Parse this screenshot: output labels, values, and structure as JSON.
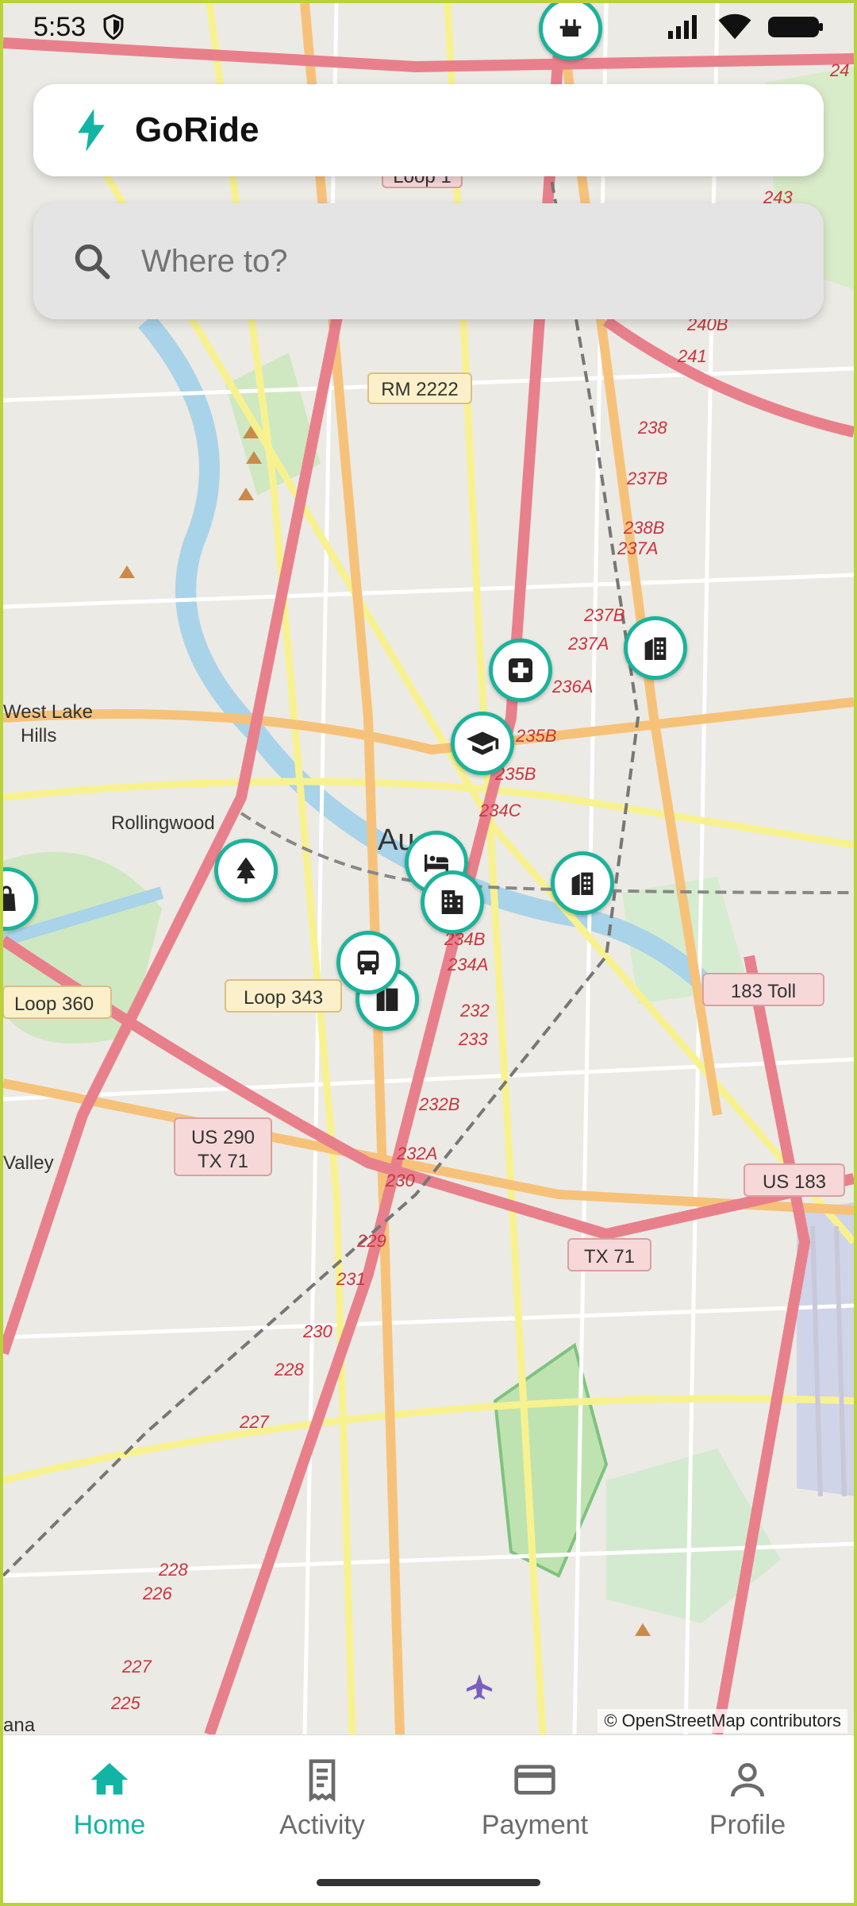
{
  "status": {
    "time": "5:53"
  },
  "brand": {
    "name": "GoRide",
    "accent": "#12b5a3"
  },
  "search": {
    "placeholder": "Where to?"
  },
  "map": {
    "places": [
      "West Lake",
      "Hills",
      "Rollingwood",
      "Valley",
      "Au",
      "ana"
    ],
    "shields": [
      "RM 2222",
      "Loop 1",
      "Loop 360",
      "Loop 343",
      "US 290",
      "TX 71",
      "183 Toll",
      "US 183",
      "TX 71"
    ],
    "exits": [
      "240B",
      "241",
      "243",
      "24",
      "238",
      "237B",
      "238B",
      "237A",
      "237B",
      "237A",
      "236A",
      "235B",
      "235B",
      "234C",
      "234B",
      "234A",
      "232",
      "233",
      "232B",
      "232A",
      "230",
      "229",
      "231",
      "230",
      "228",
      "227",
      "228",
      "226",
      "227",
      "225"
    ],
    "attribution": "© OpenStreetMap contributors"
  },
  "nav": {
    "items": [
      {
        "label": "Home",
        "icon": "home-icon",
        "active": true
      },
      {
        "label": "Activity",
        "icon": "receipt-icon",
        "active": false
      },
      {
        "label": "Payment",
        "icon": "credit-card-icon",
        "active": false
      },
      {
        "label": "Profile",
        "icon": "person-icon",
        "active": false
      }
    ]
  }
}
